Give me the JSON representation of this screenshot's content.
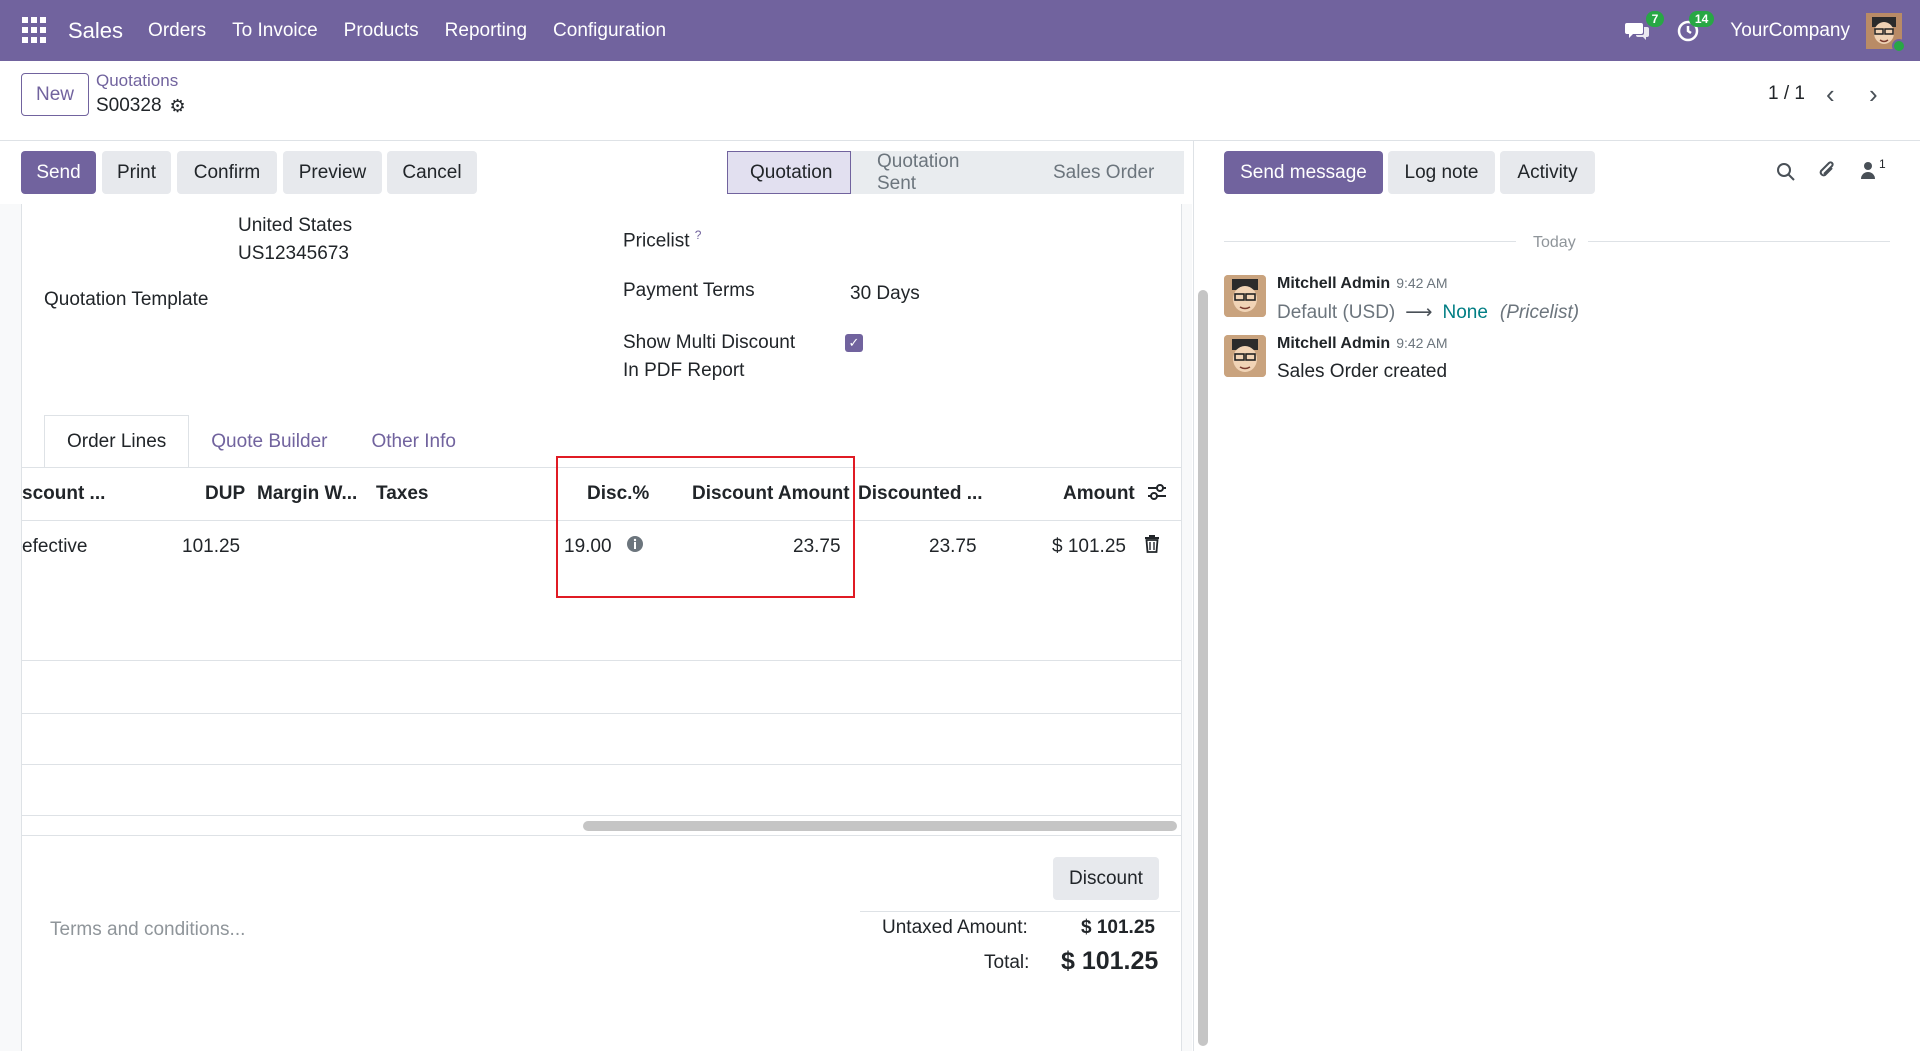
{
  "navbar": {
    "app_name": "Sales",
    "menu": [
      "Orders",
      "To Invoice",
      "Products",
      "Reporting",
      "Configuration"
    ],
    "messages_badge": "7",
    "activities_badge": "14",
    "company": "YourCompany"
  },
  "control_panel": {
    "new_label": "New",
    "breadcrumb": "Quotations",
    "record_name": "S00328",
    "pager": "1 / 1"
  },
  "statusbar": {
    "buttons": [
      "Send",
      "Print",
      "Confirm",
      "Preview",
      "Cancel"
    ],
    "stages": [
      "Quotation",
      "Quotation Sent",
      "Sales Order"
    ],
    "active_stage": "Quotation"
  },
  "form": {
    "address_line1": "United States",
    "address_line2": "US12345673",
    "quotation_template_label": "Quotation Template",
    "pricelist_label": "Pricelist",
    "pricelist_help": "?",
    "payment_terms_label": "Payment Terms",
    "payment_terms_value": "30 Days",
    "multi_discount_label_1": "Show Multi Discount",
    "multi_discount_label_2": "In PDF Report",
    "multi_discount_checked": true
  },
  "tabs": [
    "Order Lines",
    "Quote Builder",
    "Other Info"
  ],
  "order_lines": {
    "columns": [
      "scount ...",
      "DUP",
      "Margin W...",
      "Taxes",
      "Disc.%",
      "Discount Amount",
      "Discounted ...",
      "Amount"
    ],
    "rows": [
      {
        "discount_type": "efective",
        "dup": "101.25",
        "margin": "",
        "taxes": "",
        "disc_pct": "19.00",
        "discount_amount": "23.75",
        "discounted": "23.75",
        "amount": "$ 101.25"
      }
    ]
  },
  "footer": {
    "terms_placeholder": "Terms and conditions...",
    "discount_button": "Discount",
    "untaxed_label": "Untaxed Amount:",
    "untaxed_value": "$ 101.25",
    "total_label": "Total:",
    "total_value": "$ 101.25"
  },
  "chatter": {
    "send_message": "Send message",
    "log_note": "Log note",
    "activity": "Activity",
    "followers_count": "1",
    "date_separator": "Today",
    "messages": [
      {
        "author": "Mitchell Admin",
        "time": "9:42 AM",
        "old_value": "Default (USD)",
        "new_value": "None",
        "field": "(Pricelist)"
      },
      {
        "author": "Mitchell Admin",
        "time": "9:42 AM",
        "body": "Sales Order created"
      }
    ]
  },
  "colors": {
    "brand": "#71639e",
    "highlight": "#e01b24",
    "link": "#017e84",
    "badge": "#28a745"
  }
}
